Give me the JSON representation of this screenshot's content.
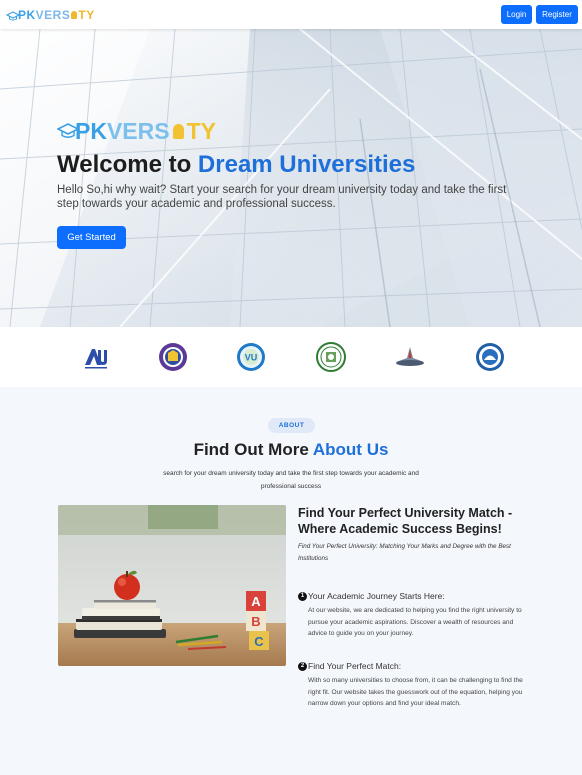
{
  "navbar": {
    "logo": {
      "pk": "PK",
      "vers": "VERS",
      "ty": "TY"
    },
    "login_label": "Login",
    "register_label": "Register"
  },
  "hero": {
    "logo": {
      "pk": "PK",
      "vers": "VERS",
      "ty": "TY"
    },
    "title_prefix": "Welcome to ",
    "title_accent": "Dream Universities",
    "subtitle": "Hello So,hi why wait? Start your search for your dream university today and take the first step towards your academic and professional success.",
    "cta_label": "Get Started"
  },
  "universities": [
    {
      "icon": "university-logo-icon",
      "label": "AU"
    },
    {
      "icon": "university-seal-icon"
    },
    {
      "icon": "university-seal-icon",
      "label": "VU"
    },
    {
      "icon": "university-seal-icon"
    },
    {
      "icon": "university-logo-icon"
    },
    {
      "icon": "university-seal-icon"
    }
  ],
  "about": {
    "badge": "ABOUT",
    "title_prefix": "Find Out More ",
    "title_accent": "About Us",
    "subtitle": "search for your dream university today and take the first step towards your academic and professional success",
    "heading": "Find Your Perfect University Match - Where Academic Success Begins!",
    "tagline": "Find Your Perfect University: Matching Your Marks and Degree with the Best Institutions",
    "features": [
      {
        "number": "1",
        "title": "Your Academic Journey Starts Here:",
        "body": "At our website, we are dedicated to helping you find the right university to pursue your academic aspirations. Discover a wealth of resources and advice to guide you on your journey."
      },
      {
        "number": "2",
        "title": "Find Your Perfect Match:",
        "body": "With so many universities to choose from, it can be challenging to find the right fit. Our website takes the guesswork out of the equation, helping you narrow down your options and find your ideal match."
      }
    ],
    "photo_blocks": [
      "A",
      "B",
      "C"
    ]
  },
  "colors": {
    "primary": "#0d6efd",
    "accent": "#1e6fd9",
    "logo_blue": "#3aa0e6",
    "logo_yellow": "#f1c232"
  }
}
